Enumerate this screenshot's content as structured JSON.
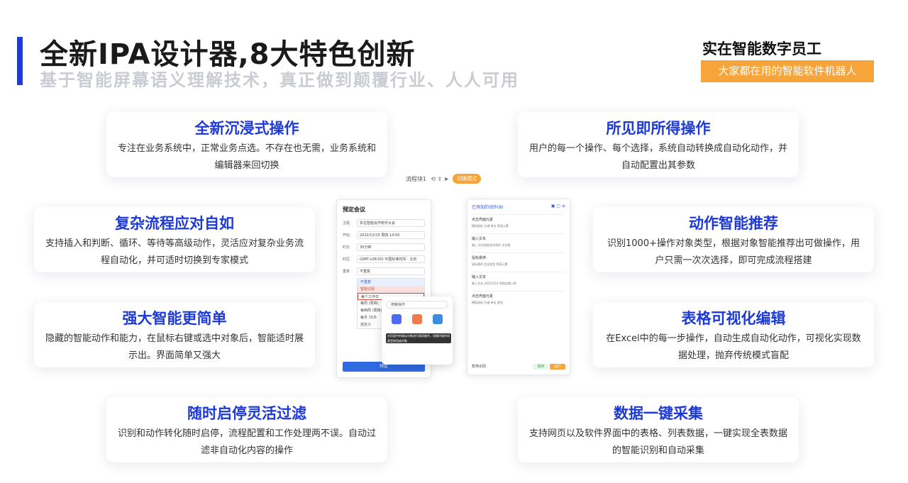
{
  "header": {
    "title": "全新IPA设计器,8大特色创新",
    "subtitle": "基于智能屏幕语义理解技术，真正做到颠覆行业、人人可用"
  },
  "brand": {
    "name": "实在智能数字员工",
    "tagline": "大家都在用的智能软件机器人"
  },
  "features": {
    "immersive": {
      "title": "全新沉浸式操作",
      "desc": "专注在业务系统中，正常业务点选。不存在也无需，业务系统和编辑器来回切换"
    },
    "wysiwyg": {
      "title": "所见即所得操作",
      "desc": "用户的每一个操作、每个选择，系统自动转换成自动化动作，并自动配置出其参数"
    },
    "complex": {
      "title": "复杂流程应对自如",
      "desc": "支持插入和判断、循环、等待等高级动作，灵活应对复杂业务流程自动化，并可适时切换到专家模式"
    },
    "recommend": {
      "title": "动作智能推荐",
      "desc": "识别1000+操作对象类型，根据对象智能推荐出可做操作，用户只需一次次选择，即可完成流程搭建"
    },
    "simple": {
      "title": "强大智能更简单",
      "desc": "隐藏的智能动作和能力，在鼠标右键或选中对象后，智能适时展示出。界面简单又强大"
    },
    "table": {
      "title": "表格可视化编辑",
      "desc": "在Excel中的每一步操作，自动生成自动化动作，可视化实现数据处理，抛弃传统模式盲配"
    },
    "pause": {
      "title": "随时启停灵活过滤",
      "desc": "识别和动作转化随时启停，流程配置和工作处理两不误。自动过滤非自动化内容的操作"
    },
    "collect": {
      "title": "数据一键采集",
      "desc": "支持网页以及软件界面中的表格、列表数据，一键实现全表数据的智能识别和自动采集"
    }
  },
  "mock": {
    "toolbar_label": "流程块1",
    "toolbar_pill": "切换模式",
    "form_title": "预定会议",
    "form_rows": [
      {
        "label": "主题",
        "value": "实在智能会作软件大会"
      },
      {
        "label": "开始",
        "value": "2022/12/15 周四   14:00"
      },
      {
        "label": "时长",
        "value": "30分钟"
      },
      {
        "label": "时区",
        "value": "(GMT+08:00) 中国标准时间 - 北京"
      },
      {
        "label": "重复",
        "value": "不重复"
      }
    ],
    "dropdown": [
      "不重复",
      "智能识别",
      "每个工作日",
      "每周 (周四)",
      "每两周 (周四)",
      "每月 15日",
      "自定义"
    ],
    "form_button": "预定",
    "popup_search": "搜索操作",
    "popup_tip": "对页面中的相似对象进行相同操作，如循环操作同类型按钮或对象",
    "actions_head": "已添加的动作(8)",
    "actions": [
      {
        "title": "点击界面元素",
        "detail": "模拟鼠标 左键 单击 界面元素"
      },
      {
        "title": "输入文本",
        "detail": "输入 实在智能会作软件 文本框"
      },
      {
        "title": "鼠标悬停",
        "detail": "鼠标悬停 会议类型 界面元素"
      },
      {
        "title": "输入文本",
        "detail": "输入文本 20221216 到指定输入框"
      },
      {
        "title": "点击界面元素",
        "detail": "模拟鼠标 左键 单击 按钮"
      }
    ],
    "actions_foot": "暂停识别",
    "save_label": "保存",
    "run_label": "运行"
  }
}
